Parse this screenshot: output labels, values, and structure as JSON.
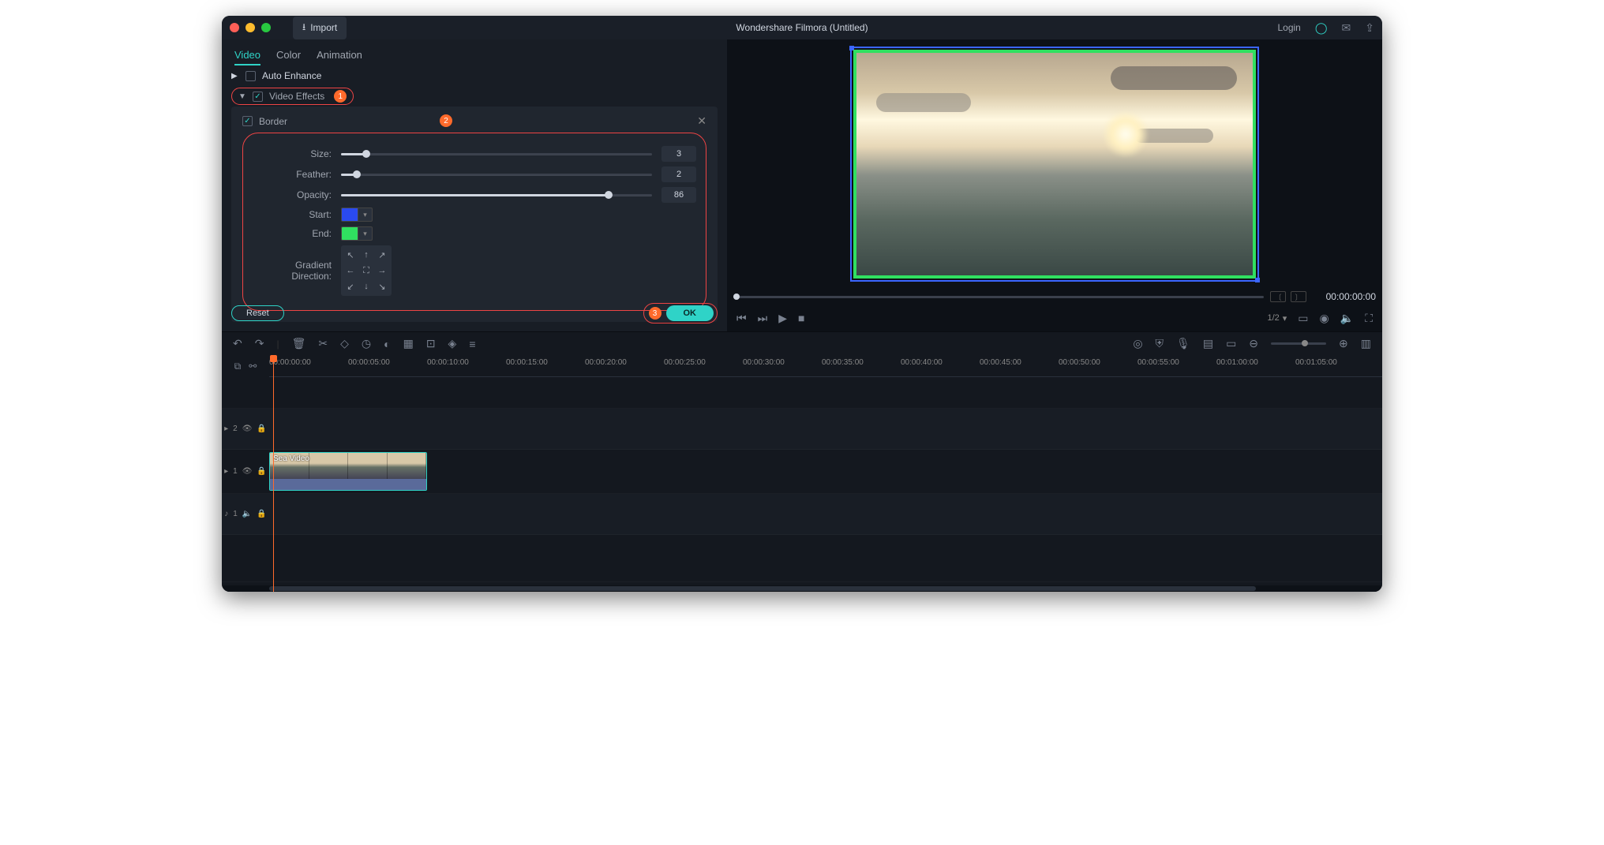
{
  "app_title": "Wondershare Filmora (Untitled)",
  "import_label": "Import",
  "login_label": "Login",
  "tabs": {
    "video": "Video",
    "color": "Color",
    "animation": "Animation"
  },
  "sections": {
    "auto_enhance": "Auto Enhance",
    "video_effects": "Video Effects",
    "border": "Border"
  },
  "badges": {
    "ve": "1",
    "frame": "2",
    "ok": "3"
  },
  "border": {
    "size_label": "Size:",
    "size_value": "3",
    "size_pct": 8,
    "feather_label": "Feather:",
    "feather_value": "2",
    "feather_pct": 5,
    "opacity_label": "Opacity:",
    "opacity_value": "86",
    "opacity_pct": 86,
    "start_label": "Start:",
    "start_color": "#2a4af0",
    "end_label": "End:",
    "end_color": "#30e060",
    "gradient_label": "Gradient Direction:"
  },
  "reset_label": "Reset",
  "ok_label": "OK",
  "preview": {
    "timecode": "00:00:00:00",
    "zoom": "1/2"
  },
  "timeline": {
    "stamps": [
      "00:00:00:00",
      "00:00:05:00",
      "00:00:10:00",
      "00:00:15:00",
      "00:00:20:00",
      "00:00:25:00",
      "00:00:30:00",
      "00:00:35:00",
      "00:00:40:00",
      "00:00:45:00",
      "00:00:50:00",
      "00:00:55:00",
      "00:01:00:00",
      "00:01:05:00"
    ],
    "clip_name": "Sea Video",
    "tracks": {
      "v2": "2",
      "v1": "1",
      "a1": "1"
    }
  }
}
